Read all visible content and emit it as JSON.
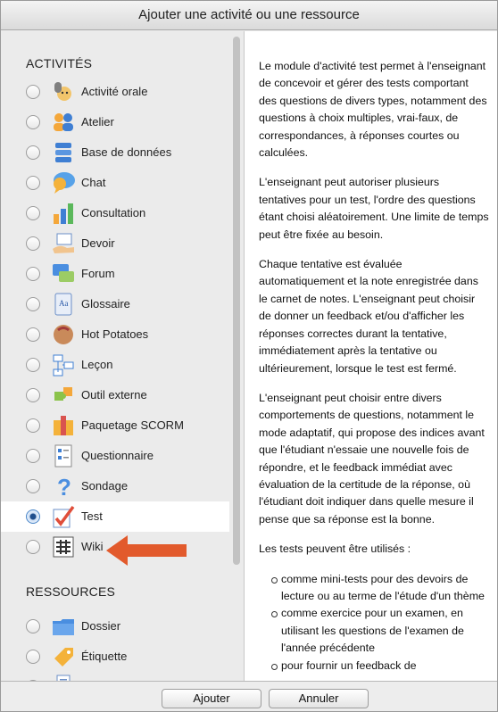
{
  "dialog": {
    "title": "Ajouter une activité ou une ressource"
  },
  "chooser": {
    "activities_header": "ACTIVITÉS",
    "resources_header": "RESSOURCES",
    "activities": [
      {
        "label": "Activité orale",
        "icon": "microphone-face-icon",
        "selected": false
      },
      {
        "label": "Atelier",
        "icon": "workshop-people-icon",
        "selected": false
      },
      {
        "label": "Base de données",
        "icon": "database-icon",
        "selected": false
      },
      {
        "label": "Chat",
        "icon": "chat-bubble-icon",
        "selected": false
      },
      {
        "label": "Consultation",
        "icon": "bar-chart-icon",
        "selected": false
      },
      {
        "label": "Devoir",
        "icon": "assignment-hand-icon",
        "selected": false
      },
      {
        "label": "Forum",
        "icon": "forum-icon",
        "selected": false
      },
      {
        "label": "Glossaire",
        "icon": "glossary-book-icon",
        "selected": false
      },
      {
        "label": "Hot Potatoes",
        "icon": "hot-potatoes-icon",
        "selected": false
      },
      {
        "label": "Leçon",
        "icon": "lesson-flow-icon",
        "selected": false
      },
      {
        "label": "Outil externe",
        "icon": "puzzle-piece-icon",
        "selected": false
      },
      {
        "label": "Paquetage SCORM",
        "icon": "scorm-package-icon",
        "selected": false
      },
      {
        "label": "Questionnaire",
        "icon": "questionnaire-icon",
        "selected": false
      },
      {
        "label": "Sondage",
        "icon": "question-mark-icon",
        "selected": false
      },
      {
        "label": "Test",
        "icon": "checkmark-test-icon",
        "selected": true
      },
      {
        "label": "Wiki",
        "icon": "wiki-icon",
        "selected": false
      }
    ],
    "resources": [
      {
        "label": "Dossier",
        "icon": "folder-icon",
        "selected": false
      },
      {
        "label": "Étiquette",
        "icon": "label-tag-icon",
        "selected": false
      }
    ]
  },
  "description": {
    "paragraphs": [
      "Le module d'activité test permet à l'enseignant de concevoir et gérer des tests comportant des questions de divers types, notamment des questions à choix multiples, vrai-faux, de correspondances, à réponses courtes ou calculées.",
      "L'enseignant peut autoriser plusieurs tentatives pour un test, l'ordre des questions étant choisi aléatoirement. Une limite de temps peut être fixée au besoin.",
      "Chaque tentative est évaluée automatiquement et la note enregistrée dans le carnet de notes. L'enseignant peut choisir de donner un feedback et/ou d'afficher les réponses correctes durant la tentative, immédiatement après la tentative ou ultérieurement, lorsque le test est fermé.",
      "L'enseignant peut choisir entre divers comportements de questions, notamment le mode adaptatif, qui propose des indices avant que l'étudiant n'essaie une nouvelle fois de répondre, et le feedback immédiat avec évaluation de la certitude de la réponse, où l'étudiant doit indiquer dans quelle mesure il pense que sa réponse est la bonne.",
      "Les tests peuvent être utilisés :"
    ],
    "bullets": [
      "comme mini-tests pour des devoirs de lecture ou au terme de l'étude d'un thème",
      "comme exercice pour un examen, en utilisant les questions de l'examen de l'année précédente",
      "pour fournir un feedback de"
    ]
  },
  "footer": {
    "add_label": "Ajouter",
    "cancel_label": "Annuler"
  },
  "colors": {
    "arrow": "#e25a2c",
    "selected_row": "#ffffff"
  }
}
